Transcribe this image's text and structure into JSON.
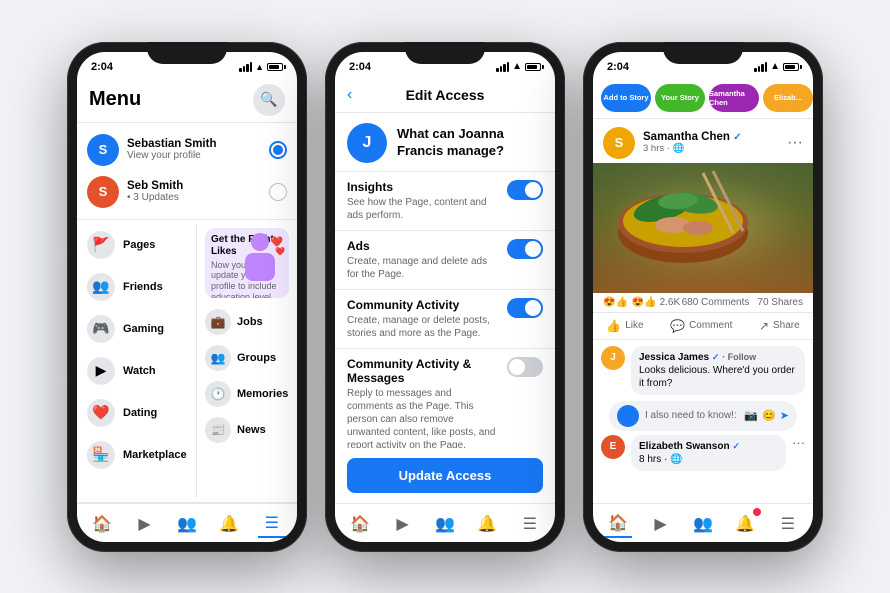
{
  "phone1": {
    "statusBar": {
      "time": "2:04"
    },
    "header": {
      "title": "Menu",
      "searchLabel": "🔍"
    },
    "profiles": [
      {
        "name": "Sebastian Smith",
        "sub": "View your profile",
        "color": "#1877f2",
        "initial": "S",
        "selected": true
      },
      {
        "name": "Seb Smith",
        "sub": "• 3 Updates",
        "color": "#e4522b",
        "initial": "S",
        "selected": false
      }
    ],
    "menuItems": [
      {
        "label": "Pages",
        "icon": "🚩",
        "iconBg": "#e4e6ea"
      },
      {
        "label": "Friends",
        "icon": "👥",
        "iconBg": "#e4e6ea"
      },
      {
        "label": "Gaming",
        "icon": "🎮",
        "iconBg": "#e4e6ea"
      },
      {
        "label": "Watch",
        "icon": "▶",
        "iconBg": "#e4e6ea"
      },
      {
        "label": "Dating",
        "icon": "❤️",
        "iconBg": "#e4e6ea"
      },
      {
        "label": "Marketplace",
        "icon": "🏪",
        "iconBg": "#e4e6ea"
      }
    ],
    "promoCard": {
      "title": "Get the Right Likes",
      "subtitle": "Now you can update your profile to include education level."
    },
    "sideItems": [
      {
        "label": "Jobs",
        "icon": "💼"
      },
      {
        "label": "Groups",
        "icon": "👥"
      },
      {
        "label": "Memories",
        "icon": "🕐"
      },
      {
        "label": "News",
        "icon": "📰"
      }
    ],
    "bottomNav": [
      "🏠",
      "▶",
      "👥",
      "🔔",
      "☰"
    ]
  },
  "phone2": {
    "statusBar": {
      "time": "2:04"
    },
    "header": {
      "back": "‹",
      "title": "Edit Access"
    },
    "who": {
      "initial": "J",
      "question": "What can Joanna Francis manage?"
    },
    "accessItems": [
      {
        "label": "Insights",
        "desc": "See how the Page, content and ads perform.",
        "on": true
      },
      {
        "label": "Ads",
        "desc": "Create, manage and delete ads for the Page.",
        "on": true
      },
      {
        "label": "Community Activity",
        "desc": "Create, manage or delete posts, stories and more as the Page.",
        "on": true
      },
      {
        "label": "Community Activity & Messages",
        "desc": "Reply to messages and comments as the Page. This person can also remove unwanted content, like posts, and report activity on the Page.",
        "on": false
      }
    ],
    "updateBtn": "Update Access",
    "bottomNav": [
      "🏠",
      "▶",
      "👥",
      "🔔",
      "☰"
    ]
  },
  "phone3": {
    "statusBar": {
      "time": "2:04"
    },
    "stories": [
      {
        "label": "Add to Story",
        "bg": "#1877f2"
      },
      {
        "label": "Your Story",
        "bg": "#42b72a"
      },
      {
        "label": "Samantha Chen",
        "bg": "#9c27b0"
      },
      {
        "label": "Elizab...",
        "bg": "#f5a623"
      }
    ],
    "post": {
      "authorName": "Samantha Chen",
      "verified": true,
      "meta": "3 hrs · 🌐",
      "reactions": "😍👍 2.6K",
      "comments": "680 Comments",
      "shares": "70 Shares",
      "likeBtn": "Like",
      "commentBtn": "Comment",
      "shareBtn": "Share"
    },
    "comments": [
      {
        "name": "Jessica James",
        "follow": "● Follow",
        "text": "Looks delicious. Where'd you order it from?",
        "avatarColor": "#f5a623",
        "initial": "J"
      },
      {
        "name": "",
        "text": "I also need to know!:",
        "avatarColor": "#e4522b",
        "initial": "E"
      }
    ],
    "inputPlaceholder": "",
    "bottomNav": [
      "🏠",
      "▶",
      "👥",
      "🔔",
      "☰"
    ]
  }
}
